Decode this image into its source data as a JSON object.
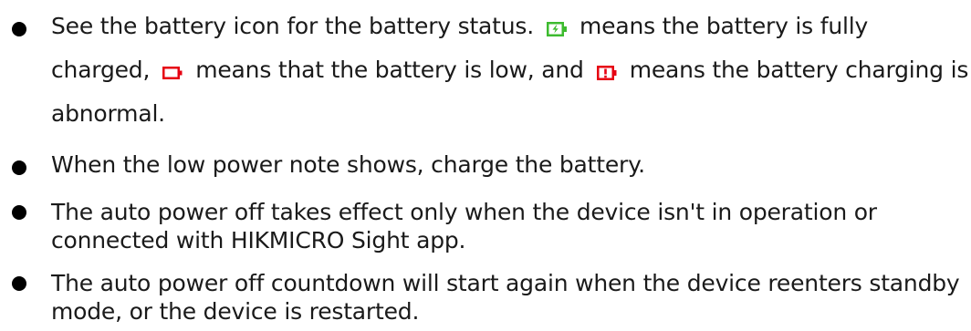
{
  "notes": {
    "item1": {
      "text_before_full": "See the battery icon for the battery status.",
      "text_after_full": "means the battery is fully charged,",
      "text_after_low": "means that the battery is low, and",
      "text_after_abnormal": "means the battery charging is abnormal.",
      "icons": {
        "full": "battery-full-charging-icon",
        "low": "battery-low-icon",
        "abnormal": "battery-abnormal-icon"
      },
      "colors": {
        "full": "#3dbb2f",
        "low": "#e60012",
        "abnormal": "#e60012"
      }
    },
    "item2": "When the low power note shows, charge the battery.",
    "item3": "The auto power off takes effect only when the device isn't in operation or connected with HIKMICRO Sight app.",
    "item4": "The auto power off countdown will start again when the device reenters standby mode, or the device is restarted."
  }
}
